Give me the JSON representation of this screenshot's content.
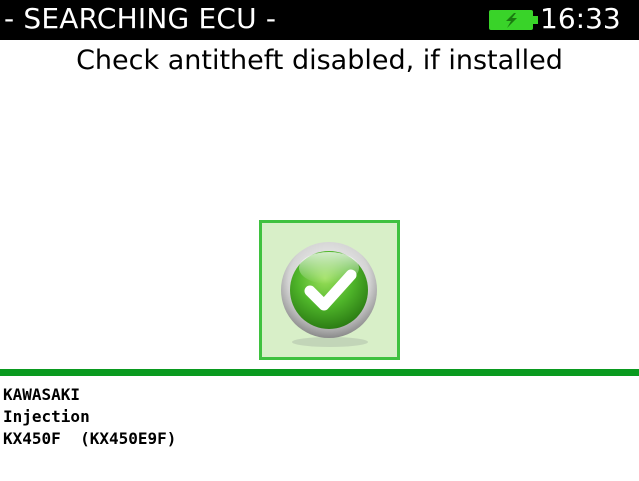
{
  "header": {
    "title": "- SEARCHING ECU -",
    "time": "16:33",
    "battery_icon": "battery-charging-icon",
    "battery_color": "#39d329"
  },
  "message": "Check antitheft disabled, if installed",
  "status": {
    "icon": "checkmark-icon",
    "accent": "#3fc13f"
  },
  "vehicle": {
    "brand": "KAWASAKI",
    "system": "Injection",
    "model": "KX450F  (KX450E9F)"
  }
}
